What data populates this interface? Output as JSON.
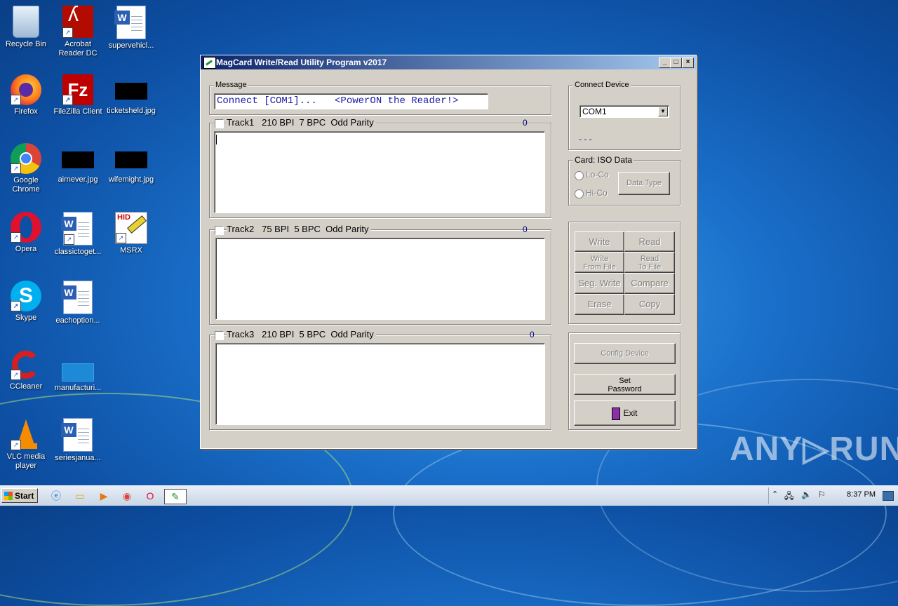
{
  "desktop": {
    "icons": [
      {
        "label": "Recycle Bin"
      },
      {
        "label": "Acrobat Reader DC"
      },
      {
        "label": "supervehicl..."
      },
      {
        "label": "Firefox"
      },
      {
        "label": "FileZilla Client"
      },
      {
        "label": "ticketsheld.jpg"
      },
      {
        "label": "Google Chrome"
      },
      {
        "label": "airnever.jpg"
      },
      {
        "label": "wifemight.jpg"
      },
      {
        "label": "Opera"
      },
      {
        "label": "classictoget..."
      },
      {
        "label": "MSRX"
      },
      {
        "label": "Skype"
      },
      {
        "label": "eachoption..."
      },
      {
        "label": "CCleaner"
      },
      {
        "label": "manufacturi..."
      },
      {
        "label": "VLC media player"
      },
      {
        "label": "seriesjanua..."
      }
    ]
  },
  "window": {
    "title": "MagCard Write/Read Utility Program  v2017",
    "controls": {
      "minimize": "_",
      "maximize": "□",
      "close": "×"
    }
  },
  "message": {
    "label": "Message",
    "text": "Connect [COM1]...   <PowerON the Reader!>"
  },
  "tracks": [
    {
      "label": "Track1   210 BPI  7 BPC  Odd Parity",
      "count": "0"
    },
    {
      "label": "Track2   75 BPI  5 BPC  Odd Parity",
      "count": "0"
    },
    {
      "label": "Track3   210 BPI  5 BPC  Odd Parity",
      "count": "0"
    }
  ],
  "connect": {
    "label": "Connect Device",
    "port": "COM1",
    "status": "- - -"
  },
  "card": {
    "label": "Card: ISO Data",
    "lo_co": "Lo-Co",
    "hi_co": "Hi-Co",
    "data_type": "Data Type"
  },
  "actions": {
    "write": "Write",
    "read": "Read",
    "write_from_file_1": "Write",
    "write_from_file_2": "From File",
    "read_to_file_1": "Read",
    "read_to_file_2": "To File",
    "seg_write": "Seg. Write",
    "compare": "Compare",
    "erase": "Erase",
    "copy": "Copy"
  },
  "config": {
    "config_device": "Config Device",
    "set_password_1": "Set",
    "set_password_2": "Password",
    "exit": "Exit"
  },
  "taskbar": {
    "start": "Start",
    "clock": "8:37 PM"
  },
  "watermark": "ANY▷RUN"
}
